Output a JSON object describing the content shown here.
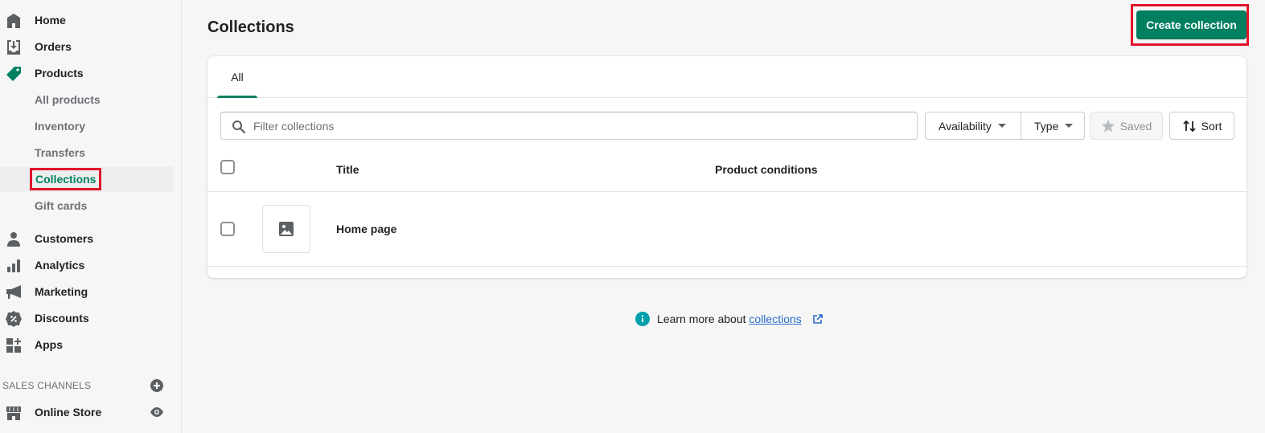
{
  "sidebar": {
    "items": [
      {
        "label": "Home",
        "icon": "home-icon"
      },
      {
        "label": "Orders",
        "icon": "orders-icon"
      },
      {
        "label": "Products",
        "icon": "tag-icon"
      },
      {
        "label": "Customers",
        "icon": "person-icon"
      },
      {
        "label": "Analytics",
        "icon": "bar-chart-icon"
      },
      {
        "label": "Marketing",
        "icon": "megaphone-icon"
      },
      {
        "label": "Discounts",
        "icon": "discount-icon"
      },
      {
        "label": "Apps",
        "icon": "apps-icon"
      }
    ],
    "products_sub": [
      {
        "label": "All products"
      },
      {
        "label": "Inventory"
      },
      {
        "label": "Transfers"
      },
      {
        "label": "Collections",
        "active": true
      },
      {
        "label": "Gift cards"
      }
    ],
    "sales_channels_title": "SALES CHANNELS",
    "channels": [
      {
        "label": "Online Store",
        "icon": "store-icon"
      }
    ]
  },
  "header": {
    "title": "Collections",
    "create_label": "Create collection"
  },
  "colors": {
    "accent": "#008060",
    "highlight": "#e0142b",
    "link": "#2c6ecb"
  },
  "tabs": [
    {
      "label": "All",
      "selected": true
    }
  ],
  "filters": {
    "search_placeholder": "Filter collections",
    "search_value": "",
    "availability_label": "Availability",
    "type_label": "Type",
    "saved_label": "Saved",
    "sort_label": "Sort"
  },
  "table": {
    "columns": [
      "Title",
      "Product conditions"
    ],
    "rows": [
      {
        "title": "Home page",
        "conditions": ""
      }
    ]
  },
  "footer": {
    "learn_prefix": "Learn more about ",
    "learn_link": "collections"
  }
}
